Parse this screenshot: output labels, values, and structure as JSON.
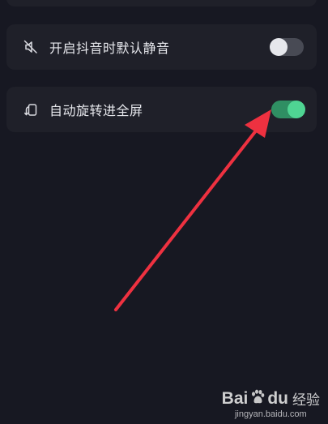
{
  "settings": {
    "items": [
      {
        "label": "开启抖音时默认静音",
        "icon": "speaker-muted-icon",
        "toggle_on": false
      },
      {
        "label": "自动旋转进全屏",
        "icon": "rotate-screen-icon",
        "toggle_on": true
      }
    ]
  },
  "colors": {
    "background": "#171822",
    "card": "#1f2029",
    "toggle_on_track": "#2f8f63",
    "toggle_on_knob": "#4fd593",
    "toggle_off_track": "#484a54",
    "annotation_arrow": "#ee3140"
  },
  "watermark": {
    "brand_left": "Bai",
    "brand_right": "du",
    "suffix": "经验",
    "url": "jingyan.baidu.com"
  }
}
